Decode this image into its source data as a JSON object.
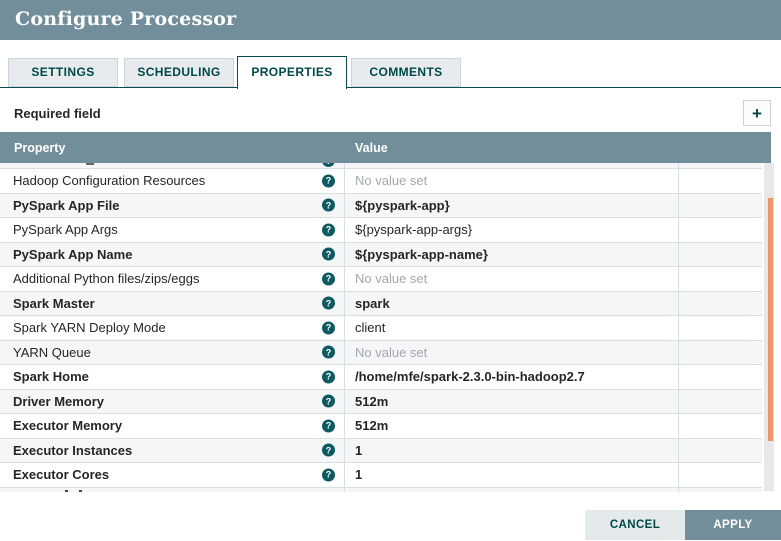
{
  "dialog": {
    "title": "Configure Processor"
  },
  "tabs": [
    {
      "label": "SETTINGS",
      "active": false
    },
    {
      "label": "SCHEDULING",
      "active": false
    },
    {
      "label": "PROPERTIES",
      "active": true
    },
    {
      "label": "COMMENTS",
      "active": false
    }
  ],
  "toolbar": {
    "required_label": "Required field",
    "add_button_glyph": "+"
  },
  "table": {
    "columns": {
      "property": "Property",
      "value": "Value"
    },
    "help_icon_glyph": "?",
    "empty_value_text": "No value set",
    "rows": [
      {
        "property": "",
        "value": "",
        "partial": "top"
      },
      {
        "property": "Hadoop Configuration Resources",
        "value": "No value set",
        "required": false,
        "value_set": false
      },
      {
        "property": "PySpark App File",
        "value": "${pyspark-app}",
        "required": true,
        "value_set": true
      },
      {
        "property": "PySpark App Args",
        "value": "${pyspark-app-args}",
        "required": false,
        "value_set": true
      },
      {
        "property": "PySpark App Name",
        "value": "${pyspark-app-name}",
        "required": true,
        "value_set": true
      },
      {
        "property": "Additional Python files/zips/eggs",
        "value": "No value set",
        "required": false,
        "value_set": false
      },
      {
        "property": "Spark Master",
        "value": "spark",
        "required": true,
        "value_set": true
      },
      {
        "property": "Spark YARN Deploy Mode",
        "value": "client",
        "required": false,
        "value_set": true
      },
      {
        "property": "YARN Queue",
        "value": "No value set",
        "required": false,
        "value_set": false
      },
      {
        "property": "Spark Home",
        "value": "/home/mfe/spark-2.3.0-bin-hadoop2.7",
        "required": true,
        "value_set": true
      },
      {
        "property": "Driver Memory",
        "value": "512m",
        "required": true,
        "value_set": true
      },
      {
        "property": "Executor Memory",
        "value": "512m",
        "required": true,
        "value_set": true
      },
      {
        "property": "Executor Instances",
        "value": "1",
        "required": true,
        "value_set": true
      },
      {
        "property": "Executor Cores",
        "value": "1",
        "required": true,
        "value_set": true
      },
      {
        "property": "",
        "value": "",
        "partial": "bottom"
      }
    ]
  },
  "footer": {
    "cancel_label": "CANCEL",
    "apply_label": "APPLY"
  },
  "colors": {
    "header_bg": "#728e9b",
    "accent_teal": "#004849",
    "tab_border_active": "#0a4b50",
    "row_alt_bg": "#f4f6f7",
    "unset_value_text": "#a2a8ab",
    "scrollbar_thumb": "#ef946f",
    "apply_button_bg": "#728e9b"
  }
}
